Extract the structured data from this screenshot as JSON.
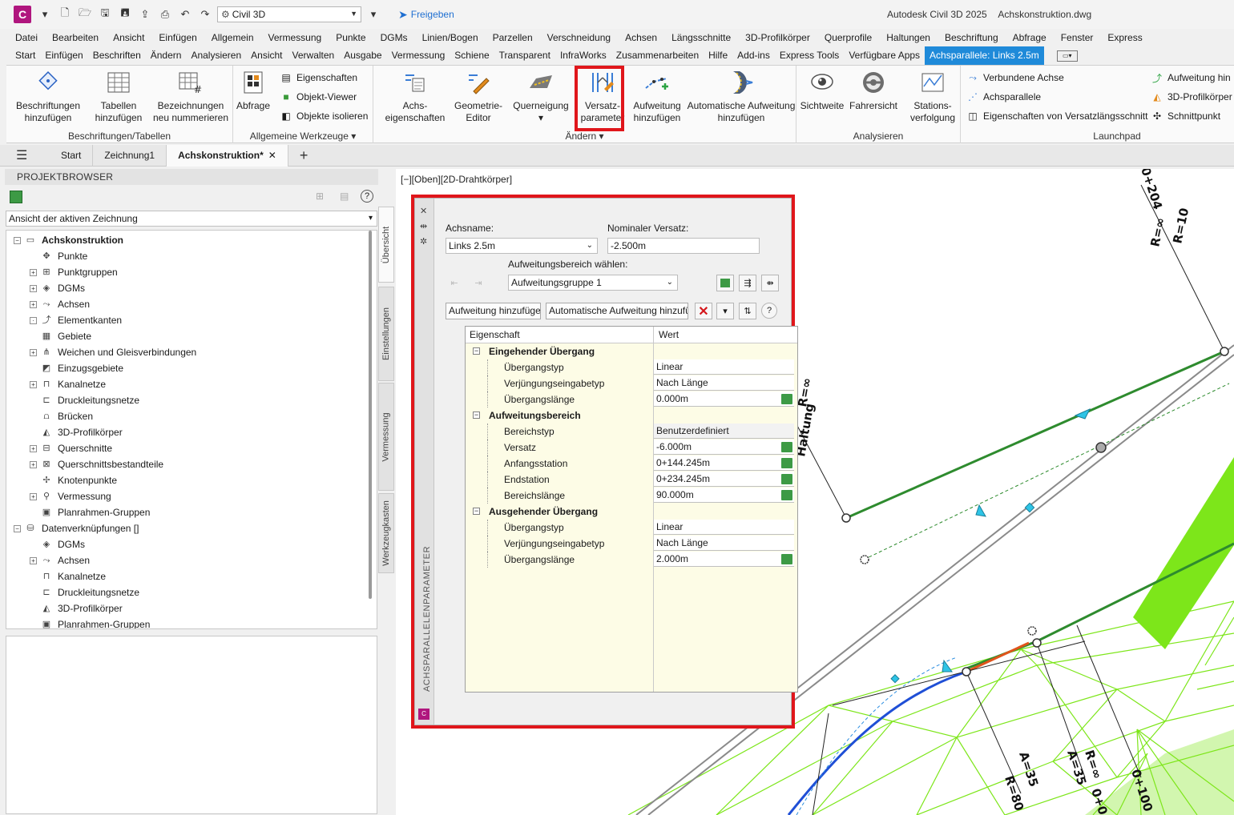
{
  "app": {
    "logo_letter": "C",
    "workspace": "Civil 3D",
    "share": "Freigeben",
    "product": "Autodesk Civil 3D 2025",
    "file": "Achskonstruktion.dwg"
  },
  "menu": [
    "Datei",
    "Bearbeiten",
    "Ansicht",
    "Einfügen",
    "Allgemein",
    "Vermessung",
    "Punkte",
    "DGMs",
    "Linien/Bogen",
    "Parzellen",
    "Verschneidung",
    "Achsen",
    "Längsschnitte",
    "3D-Profilkörper",
    "Querprofile",
    "Haltungen",
    "Beschriftung",
    "Abfrage",
    "Fenster",
    "Express"
  ],
  "ribbon_tabs": [
    "Start",
    "Einfügen",
    "Beschriften",
    "Ändern",
    "Analysieren",
    "Ansicht",
    "Verwalten",
    "Ausgabe",
    "Vermessung",
    "Schiene",
    "Transparent",
    "InfraWorks",
    "Zusammenarbeiten",
    "Hilfe",
    "Add-ins",
    "Express Tools",
    "Verfügbare Apps",
    "Achsparallele: Links 2.5m"
  ],
  "ribbon": {
    "panels": {
      "beschriftungen": "Beschriftungen/Tabellen",
      "allgemein": "Allgemeine Werkzeuge",
      "aendern": "Ändern",
      "analysieren": "Analysieren",
      "launchpad": "Launchpad"
    },
    "buttons": {
      "beschriftungen_hinzufuegen": [
        "Beschriftungen",
        "hinzufügen"
      ],
      "tabellen_hinzufuegen": [
        "Tabellen",
        "hinzufügen"
      ],
      "bezeichnungen_nummerieren": [
        "Bezeichnungen",
        "neu nummerieren"
      ],
      "abfrage": "Abfrage",
      "eigenschaften": "Eigenschaften",
      "objekt_viewer": "Objekt-Viewer",
      "objekte_isolieren": "Objekte isolieren",
      "achseigenschaften": [
        "Achs-",
        "eigenschaften"
      ],
      "geometrie_editor": [
        "Geometrie-",
        "Editor"
      ],
      "querneigung": "Querneigung",
      "versatzparameter": [
        "Versatz-",
        "parameter"
      ],
      "aufweitung_hinzufuegen": [
        "Aufweitung",
        "hinzufügen"
      ],
      "auto_aufweitung": [
        "Automatische Aufweitung",
        "hinzufügen"
      ],
      "sichtweite": "Sichtweite",
      "fahrersicht": "Fahrersicht",
      "stationsverfolgung": [
        "Stations-",
        "verfolgung"
      ],
      "verbundene_achse": "Verbundene Achse",
      "achsparallele": "Achsparallele",
      "eigenschaften_versatz": "Eigenschaften von Versatzlängsschnitt",
      "aufweitung_hin": "Aufweitung hin",
      "profilkoerper_3d": "3D-Profilkörper",
      "schnittpunkt": "Schnittpunkt"
    }
  },
  "doc_tabs": [
    "Start",
    "Zeichnung1",
    "Achskonstruktion*"
  ],
  "browser": {
    "title": "PROJEKTBROWSER",
    "view_select": "Ansicht der aktiven Zeichnung",
    "tree": [
      {
        "label": "Achskonstruktion",
        "level": 0,
        "exp": "-",
        "bold": true,
        "icon": "drawing-icon"
      },
      {
        "label": "Punkte",
        "level": 1,
        "exp": "",
        "icon": "points-icon"
      },
      {
        "label": "Punktgruppen",
        "level": 1,
        "exp": "+",
        "icon": "point-groups-icon"
      },
      {
        "label": "DGMs",
        "level": 1,
        "exp": "+",
        "icon": "surfaces-icon"
      },
      {
        "label": "Achsen",
        "level": 1,
        "exp": "+",
        "icon": "alignments-icon"
      },
      {
        "label": "Elementkanten",
        "level": 1,
        "exp": "■",
        "icon": "feature-lines-icon"
      },
      {
        "label": "Gebiete",
        "level": 1,
        "exp": "",
        "icon": "sites-icon"
      },
      {
        "label": "Weichen und Gleisverbindungen",
        "level": 1,
        "exp": "+",
        "icon": "turnouts-icon"
      },
      {
        "label": "Einzugsgebiete",
        "level": 1,
        "exp": "",
        "icon": "catchments-icon"
      },
      {
        "label": "Kanalnetze",
        "level": 1,
        "exp": "+",
        "icon": "pipe-networks-icon"
      },
      {
        "label": "Druckleitungsnetze",
        "level": 1,
        "exp": "",
        "icon": "pressure-networks-icon"
      },
      {
        "label": "Brücken",
        "level": 1,
        "exp": "",
        "icon": "bridges-icon"
      },
      {
        "label": "3D-Profilkörper",
        "level": 1,
        "exp": "",
        "icon": "corridors-icon"
      },
      {
        "label": "Querschnitte",
        "level": 1,
        "exp": "+",
        "icon": "assemblies-icon"
      },
      {
        "label": "Querschnittsbestandteile",
        "level": 1,
        "exp": "+",
        "icon": "subassemblies-icon"
      },
      {
        "label": "Knotenpunkte",
        "level": 1,
        "exp": "",
        "icon": "intersections-icon"
      },
      {
        "label": "Vermessung",
        "level": 1,
        "exp": "+",
        "icon": "survey-icon"
      },
      {
        "label": "Planrahmen-Gruppen",
        "level": 1,
        "exp": "",
        "icon": "view-frame-groups-icon"
      },
      {
        "label": "Datenverknüpfungen []",
        "level": 0,
        "exp": "-",
        "bold": false,
        "icon": "data-shortcuts-icon"
      },
      {
        "label": "DGMs",
        "level": 1,
        "exp": "",
        "icon": "surfaces-icon"
      },
      {
        "label": "Achsen",
        "level": 1,
        "exp": "+",
        "icon": "alignments-icon"
      },
      {
        "label": "Kanalnetze",
        "level": 1,
        "exp": "",
        "icon": "pipe-networks-icon"
      },
      {
        "label": "Druckleitungsnetze",
        "level": 1,
        "exp": "",
        "icon": "pressure-networks-icon"
      },
      {
        "label": "3D-Profilkörper",
        "level": 1,
        "exp": "",
        "icon": "corridors-icon"
      },
      {
        "label": "Planrahmen-Gruppen",
        "level": 1,
        "exp": "",
        "icon": "view-frame-groups-icon"
      }
    ],
    "side_tabs": [
      "Übersicht",
      "Einstellungen",
      "Vermessung",
      "Werkzeugkasten"
    ]
  },
  "viewport": {
    "label": "[−][Oben][2D-Drahtkörper]",
    "annotations": [
      "0+204",
      "R=∞",
      "R=10",
      "R=∞",
      "Haltung",
      "A=35",
      "R=80",
      "A=35",
      "R=∞",
      "0+100",
      "0+0"
    ]
  },
  "palette": {
    "vertical_title": "ACHSPARALLELENPARAMETER",
    "achsname_label": "Achsname:",
    "achsname_value": "Links 2.5m",
    "versatz_label": "Nominaler Versatz:",
    "versatz_value": "-2.500m",
    "bereich_label": "Aufweitungsbereich wählen:",
    "bereich_value": "Aufweitungsgruppe 1",
    "btn_add": "Aufweitung hinzufügen",
    "btn_auto": "Automatische Aufweitung hinzufügen",
    "col_prop": "Eigenschaft",
    "col_val": "Wert",
    "rows": [
      {
        "name": "Eingehender Übergang",
        "group": true
      },
      {
        "name": "Übergangstyp",
        "value": "Linear"
      },
      {
        "name": "Verjüngungseingabetyp",
        "value": "Nach Länge"
      },
      {
        "name": "Übergangslänge",
        "value": "0.000m",
        "pick": true
      },
      {
        "name": "Aufweitungsbereich",
        "group": true
      },
      {
        "name": "Bereichstyp",
        "value": "Benutzerdefiniert",
        "ro": true
      },
      {
        "name": "Versatz",
        "value": "-6.000m",
        "pick": true
      },
      {
        "name": "Anfangsstation",
        "value": "0+144.245m",
        "pick": true
      },
      {
        "name": "Endstation",
        "value": "0+234.245m",
        "pick": true
      },
      {
        "name": "Bereichslänge",
        "value": "90.000m",
        "pick": true
      },
      {
        "name": "Ausgehender Übergang",
        "group": true
      },
      {
        "name": "Übergangstyp",
        "value": "Linear"
      },
      {
        "name": "Verjüngungseingabetyp",
        "value": "Nach Länge"
      },
      {
        "name": "Übergangslänge",
        "value": "2.000m",
        "pick": true
      }
    ]
  }
}
